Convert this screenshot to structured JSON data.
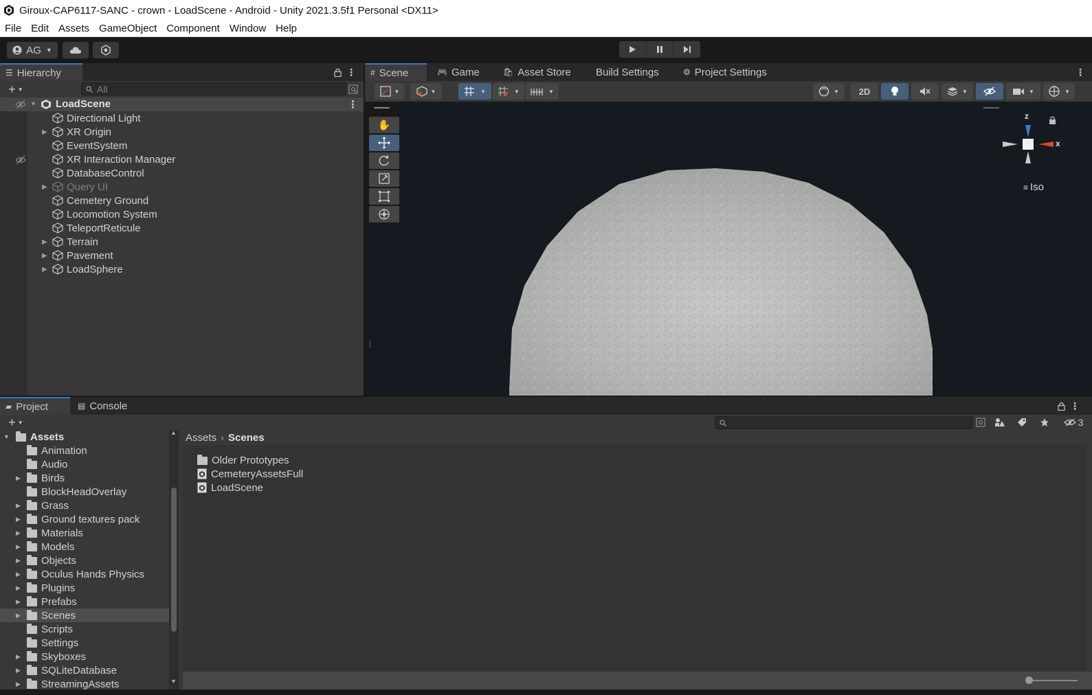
{
  "window": {
    "title": "Giroux-CAP6117-SANC - crown - LoadScene - Android - Unity 2021.3.5f1 Personal <DX11>"
  },
  "menu": [
    "File",
    "Edit",
    "Assets",
    "GameObject",
    "Component",
    "Window",
    "Help"
  ],
  "toolbar": {
    "account_label": "AG"
  },
  "hierarchy": {
    "tab_label": "Hierarchy",
    "search_placeholder": "All",
    "scene_name": "LoadScene",
    "items": [
      {
        "label": "Directional Light",
        "expandable": false,
        "dim": false
      },
      {
        "label": "XR Origin",
        "expandable": true,
        "dim": false
      },
      {
        "label": "EventSystem",
        "expandable": false,
        "dim": false
      },
      {
        "label": "XR Interaction Manager",
        "expandable": false,
        "dim": false
      },
      {
        "label": "DatabaseControl",
        "expandable": false,
        "dim": false
      },
      {
        "label": "Query UI",
        "expandable": true,
        "dim": true
      },
      {
        "label": "Cemetery Ground",
        "expandable": false,
        "dim": false
      },
      {
        "label": "Locomotion System",
        "expandable": false,
        "dim": false
      },
      {
        "label": "TeleportReticule",
        "expandable": false,
        "dim": false
      },
      {
        "label": "Terrain",
        "expandable": true,
        "dim": false
      },
      {
        "label": "Pavement",
        "expandable": true,
        "dim": false
      },
      {
        "label": "LoadSphere",
        "expandable": true,
        "dim": false
      }
    ]
  },
  "scene_tabs": {
    "scene": "Scene",
    "game": "Game",
    "asset_store": "Asset Store",
    "build_settings": "Build Settings",
    "project_settings": "Project Settings"
  },
  "scene_toolbar": {
    "mode_2d": "2D"
  },
  "gizmo": {
    "z": "z",
    "x": "x",
    "projection": "Iso"
  },
  "project": {
    "tab_project": "Project",
    "tab_console": "Console",
    "hidden_count": "3",
    "breadcrumb": {
      "root": "Assets",
      "current": "Scenes"
    },
    "tree_root": "Assets",
    "tree": [
      {
        "label": "Animation",
        "expandable": false
      },
      {
        "label": "Audio",
        "expandable": false
      },
      {
        "label": "Birds",
        "expandable": true
      },
      {
        "label": "BlockHeadOverlay",
        "expandable": false
      },
      {
        "label": "Grass",
        "expandable": true
      },
      {
        "label": "Ground textures pack",
        "expandable": true
      },
      {
        "label": "Materials",
        "expandable": true
      },
      {
        "label": "Models",
        "expandable": true
      },
      {
        "label": "Objects",
        "expandable": true
      },
      {
        "label": "Oculus Hands Physics",
        "expandable": true
      },
      {
        "label": "Plugins",
        "expandable": true
      },
      {
        "label": "Prefabs",
        "expandable": true
      },
      {
        "label": "Scenes",
        "expandable": true,
        "selected": true
      },
      {
        "label": "Scripts",
        "expandable": false
      },
      {
        "label": "Settings",
        "expandable": false
      },
      {
        "label": "Skyboxes",
        "expandable": true
      },
      {
        "label": "SQLiteDatabase",
        "expandable": true
      },
      {
        "label": "StreamingAssets",
        "expandable": true
      }
    ],
    "files": [
      {
        "label": "Older Prototypes",
        "type": "folder"
      },
      {
        "label": "CemeteryAssetsFull",
        "type": "scene"
      },
      {
        "label": "LoadScene",
        "type": "scene"
      }
    ]
  },
  "colors": {
    "accent": "#3a79bb",
    "panel": "#383838",
    "scene_bg": "#141a1f",
    "gizmo_x": "#e0442c",
    "gizmo_z": "#3a7bd5"
  }
}
